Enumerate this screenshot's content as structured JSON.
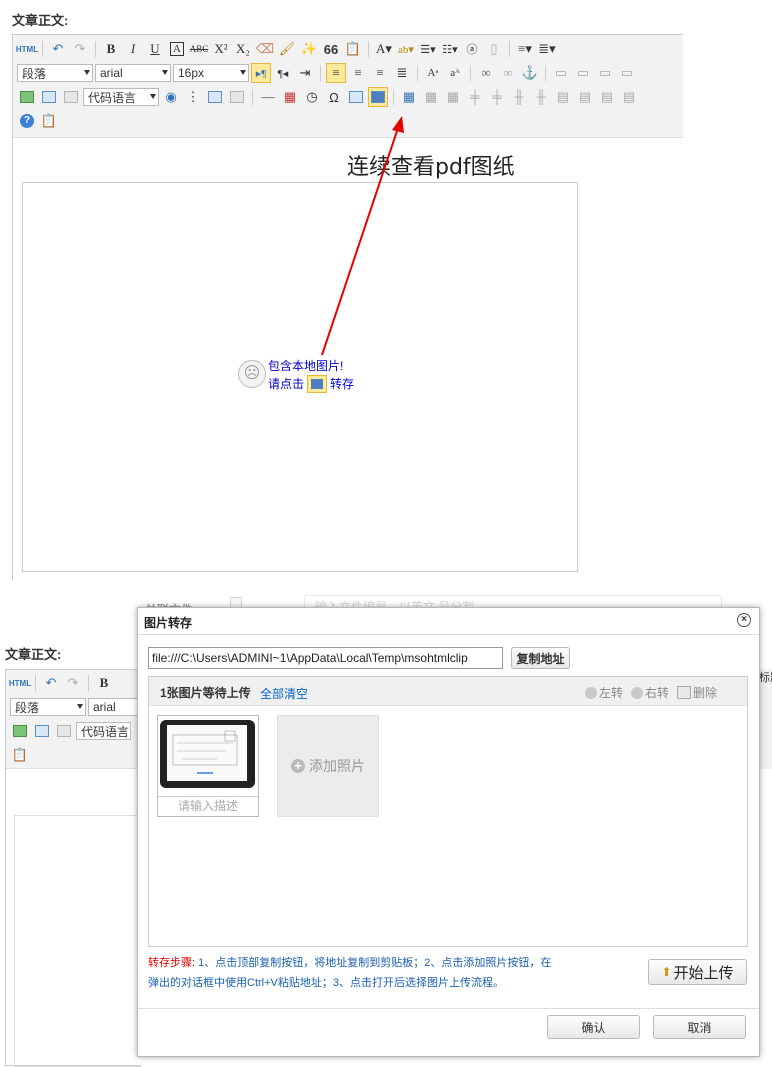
{
  "section_label": "文章正文:",
  "toolbar": {
    "html_button": "HTML",
    "paragraph": "段落",
    "font_family": "arial",
    "font_size": "16px",
    "code_language": "代码语言",
    "link_text": "链接",
    "symbol_omega": "Ω",
    "bold": "B",
    "italic": "I",
    "underline": "U",
    "quote": "66"
  },
  "annotation": {
    "caption": "连续查看pdf图纸",
    "arrow_color": "#e60000"
  },
  "placeholder_image": {
    "line1": "包含本地图片!",
    "line2_prefix": "请点击",
    "line2_suffix": "转存"
  },
  "background_form": {
    "attachments_label": "关联文件",
    "search_placeholder": "输入文件编号，以英文,号分割"
  },
  "dialog": {
    "title": "图片转存",
    "path_value": "file:///C:\\Users\\ADMINI~1\\AppData\\Local\\Temp\\msohtmlclip",
    "copy_button": "复制地址",
    "upload_count": "1张图片等待上传",
    "clear_all": "全部清空",
    "rotate_left": "左转",
    "rotate_right": "右转",
    "delete": "删除",
    "thumb_description": "请输入描述",
    "add_photo": "添加照片",
    "steps_label": "转存步骤:",
    "steps_text_1": "1、点击顶部复制按钮，将地址复制到剪贴板；2、点击添加照片按钮，在",
    "steps_text_2": "弹出的对话框中使用Ctrl+V粘贴地址；3、点击打开后选择图片上传流程。",
    "start_upload": "开始上传",
    "confirm": "确认",
    "cancel": "取消"
  },
  "right_cut_text": "标题",
  "colors": {
    "accent_blue": "#0000cc",
    "steps_red": "#e60000",
    "steps_blue": "#1a5fb4",
    "link_blue": "#0064c8"
  }
}
